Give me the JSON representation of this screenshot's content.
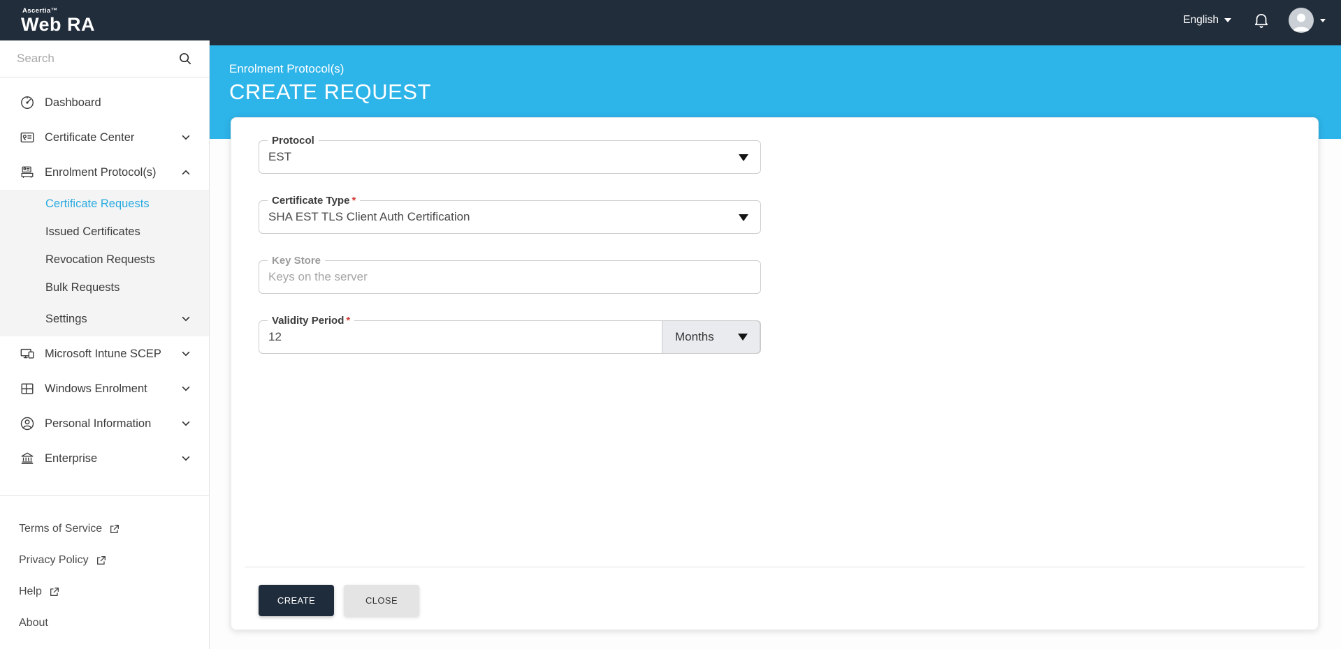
{
  "navbar": {
    "brand_top": "Ascertia™",
    "brand": "Web RA",
    "language": "English"
  },
  "sidebar": {
    "search": {
      "placeholder": "Search"
    },
    "items": [
      {
        "label": "Dashboard",
        "icon": "gauge-icon"
      },
      {
        "label": "Certificate Center",
        "icon": "certificate-icon",
        "chevron": "down"
      },
      {
        "label": "Enrolment Protocol(s)",
        "icon": "card-printer-icon",
        "chevron": "up",
        "expanded": true
      },
      {
        "label": "Microsoft Intune SCEP",
        "icon": "devices-icon",
        "chevron": "down"
      },
      {
        "label": "Windows Enrolment",
        "icon": "windows-icon",
        "chevron": "down"
      },
      {
        "label": "Personal Information",
        "icon": "person-icon",
        "chevron": "down"
      },
      {
        "label": "Enterprise",
        "icon": "bank-icon",
        "chevron": "down"
      }
    ],
    "submenu": [
      {
        "label": "Certificate Requests",
        "active": true
      },
      {
        "label": "Issued Certificates",
        "active": false
      },
      {
        "label": "Revocation Requests",
        "active": false
      },
      {
        "label": "Bulk Requests",
        "active": false
      },
      {
        "label": "Settings",
        "active": false,
        "chevron": "down"
      }
    ],
    "footer_links": [
      {
        "label": "Terms of Service",
        "external": true
      },
      {
        "label": "Privacy Policy",
        "external": true
      },
      {
        "label": "Help",
        "external": true
      },
      {
        "label": "About",
        "external": false
      }
    ]
  },
  "page_header": {
    "breadcrumb": "Enrolment Protocol(s)",
    "title": "CREATE REQUEST"
  },
  "form": {
    "required_marker": "*",
    "fields": [
      {
        "label": "Protocol",
        "value": "EST",
        "type": "select",
        "required": false
      },
      {
        "label": "Certificate Type",
        "value": "SHA EST TLS Client Auth Certification",
        "type": "select",
        "required": true
      },
      {
        "label": "Key Store",
        "value": "Keys on the server",
        "type": "text-disabled",
        "required": false
      },
      {
        "label": "Validity Period",
        "value": "12",
        "unit": "Months",
        "type": "input-group",
        "required": true
      }
    ],
    "buttons": [
      {
        "label": "CREATE"
      },
      {
        "label": "CLOSE"
      }
    ]
  },
  "colors": {
    "navbar_bg": "#222d3b",
    "header_blue": "#2db4e9",
    "active_link_blue": "#29abe2",
    "primary_button_bg": "#1f2c3c",
    "required_red": "#d43f3a"
  }
}
